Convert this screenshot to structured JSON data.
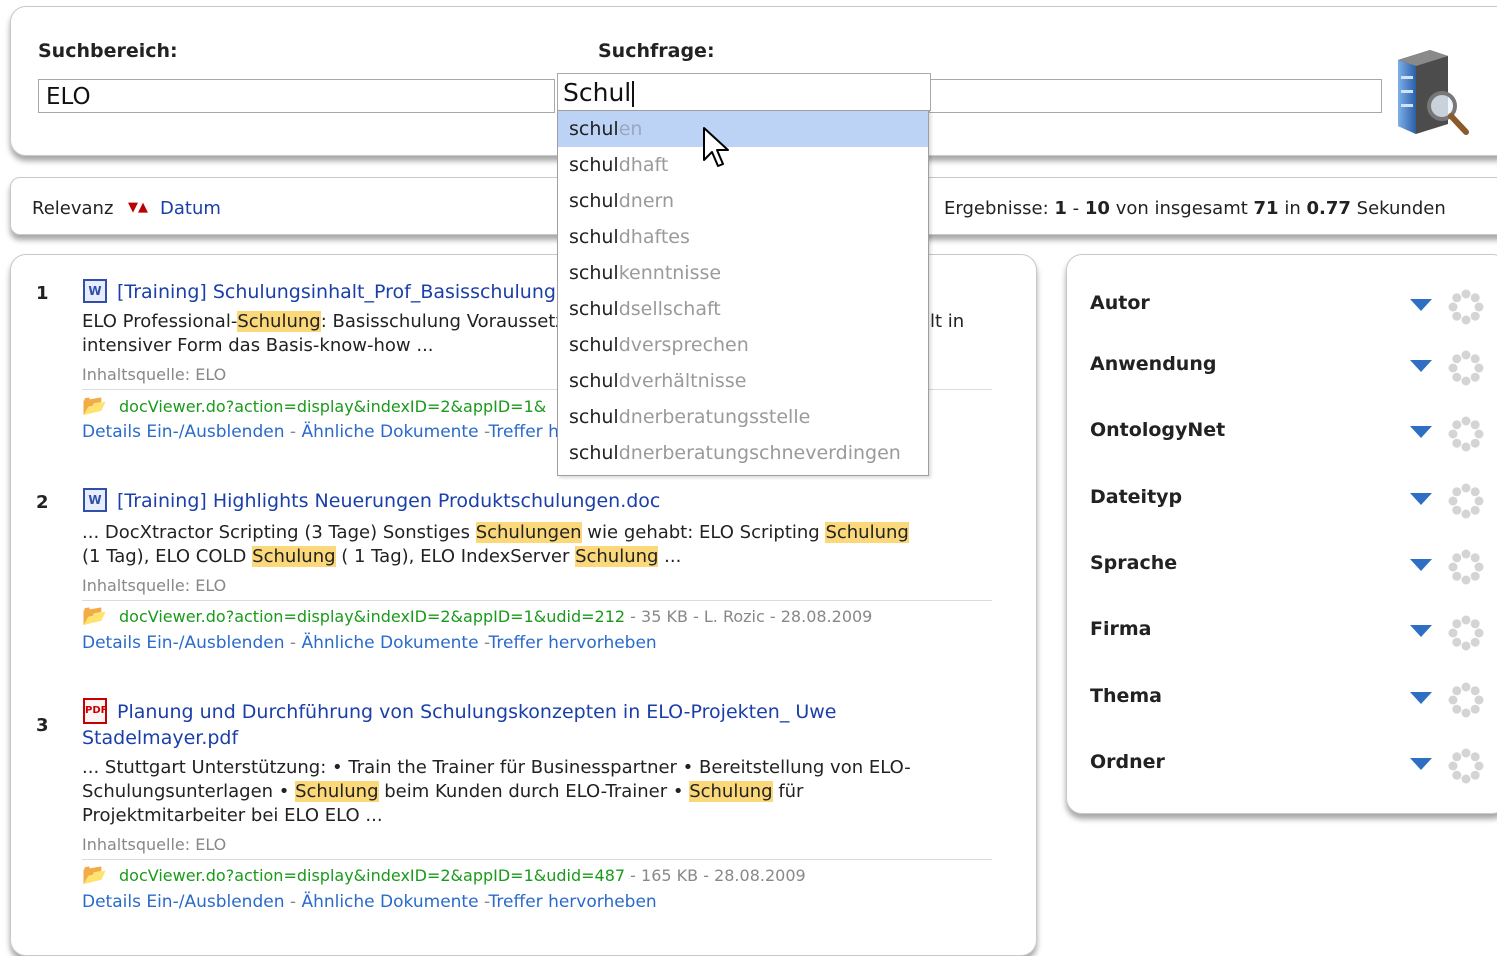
{
  "search": {
    "scope_label": "Suchbereich:",
    "scope_value": "ELO",
    "query_label": "Suchfrage:",
    "query_value": "Schul"
  },
  "autocomplete": {
    "prefix": "schul",
    "items": [
      {
        "rest": "en",
        "selected": true
      },
      {
        "rest": "dhaft"
      },
      {
        "rest": "dnern"
      },
      {
        "rest": "dhaftes"
      },
      {
        "rest": "kenntnisse"
      },
      {
        "rest": "dsellschaft"
      },
      {
        "rest": "dversprechen"
      },
      {
        "rest": "dverhältnisse"
      },
      {
        "rest": "dnerberatungsstelle"
      },
      {
        "rest": "dnerberatungschneverdingen"
      }
    ]
  },
  "sort": {
    "relevance_label": "Relevanz",
    "date_label": "Datum"
  },
  "results_info": {
    "prefix": "Ergebnisse:",
    "from": "1",
    "to": "10",
    "von": "von insgesamt",
    "total": "71",
    "in": "in",
    "seconds": "0.77",
    "suffix": "Sekunden"
  },
  "results": [
    {
      "num": "1",
      "icon": "word-doc-icon",
      "title": "[Training] Schulungsinhalt_Prof_Basisschulung",
      "snippet_1_pre": "ELO Professional-",
      "snippet_1_hl": "Schulung",
      "snippet_1_post": ": Basisschulung Voraussetzung",
      "snippet_1_tail": "lt in",
      "snippet_2": "intensiver Form das Basis-know-how ...",
      "source": "Inhaltsquelle: ELO",
      "url": "docViewer.do?action=display&indexID=2&appID=1&",
      "actions": {
        "details": "Details Ein-/Ausblenden",
        "similar": "Ähnliche Dokumente",
        "highlight": "Treffer hervorheben"
      }
    },
    {
      "num": "2",
      "icon": "word-doc-icon",
      "title": "[Training] Highlights Neuerungen Produktschulungen.doc",
      "s_a": "... DocXtractor Scripting (3 Tage) Sonstiges ",
      "s_b": "Schulungen",
      "s_c": " wie gehabt: ELO Scripting ",
      "s_d": "Schulung",
      "s_e": "(1 Tag), ELO COLD ",
      "s_f": "Schulung",
      "s_g": " ( 1 Tag), ELO IndexServer ",
      "s_h": "Schulung",
      "s_i": " ...",
      "source": "Inhaltsquelle: ELO",
      "url": "docViewer.do?action=display&indexID=2&appID=1&udid=212",
      "meta": " - 35 KB - L. Rozic - 28.08.2009",
      "actions": {
        "details": "Details Ein-/Ausblenden",
        "similar": "Ähnliche Dokumente",
        "highlight": "Treffer hervorheben"
      }
    },
    {
      "num": "3",
      "icon": "pdf-icon",
      "title_1": "Planung und Durchführung von Schulungskonzepten in ELO-Projekten_ Uwe",
      "title_2": "Stadelmayer.pdf",
      "s_a": "... Stuttgart Unterstützung: • Train the Trainer für Businesspartner • Bereitstellung von ELO-",
      "s_b": "Schulungsunterlagen • ",
      "s_c": "Schulung",
      "s_d": " beim Kunden durch ELO-Trainer • ",
      "s_e": "Schulung",
      "s_f": " für",
      "s_g": "Projektmitarbeiter bei ELO ELO ...",
      "source": "Inhaltsquelle: ELO",
      "url": "docViewer.do?action=display&indexID=2&appID=1&udid=487",
      "meta": " - 165 KB - 28.08.2009",
      "actions": {
        "details": "Details Ein-/Ausblenden",
        "similar": "Ähnliche Dokumente",
        "highlight": "Treffer hervorheben"
      }
    }
  ],
  "action_sep": "-",
  "facets": [
    "Autor",
    "Anwendung",
    "OntologyNet",
    "Dateityp",
    "Sprache",
    "Firma",
    "Thema",
    "Ordner"
  ],
  "colors": {
    "link": "#1a3fa8",
    "url": "#1a9a1a",
    "highlight": "#fbd97a",
    "selection": "#bcd3f5"
  }
}
